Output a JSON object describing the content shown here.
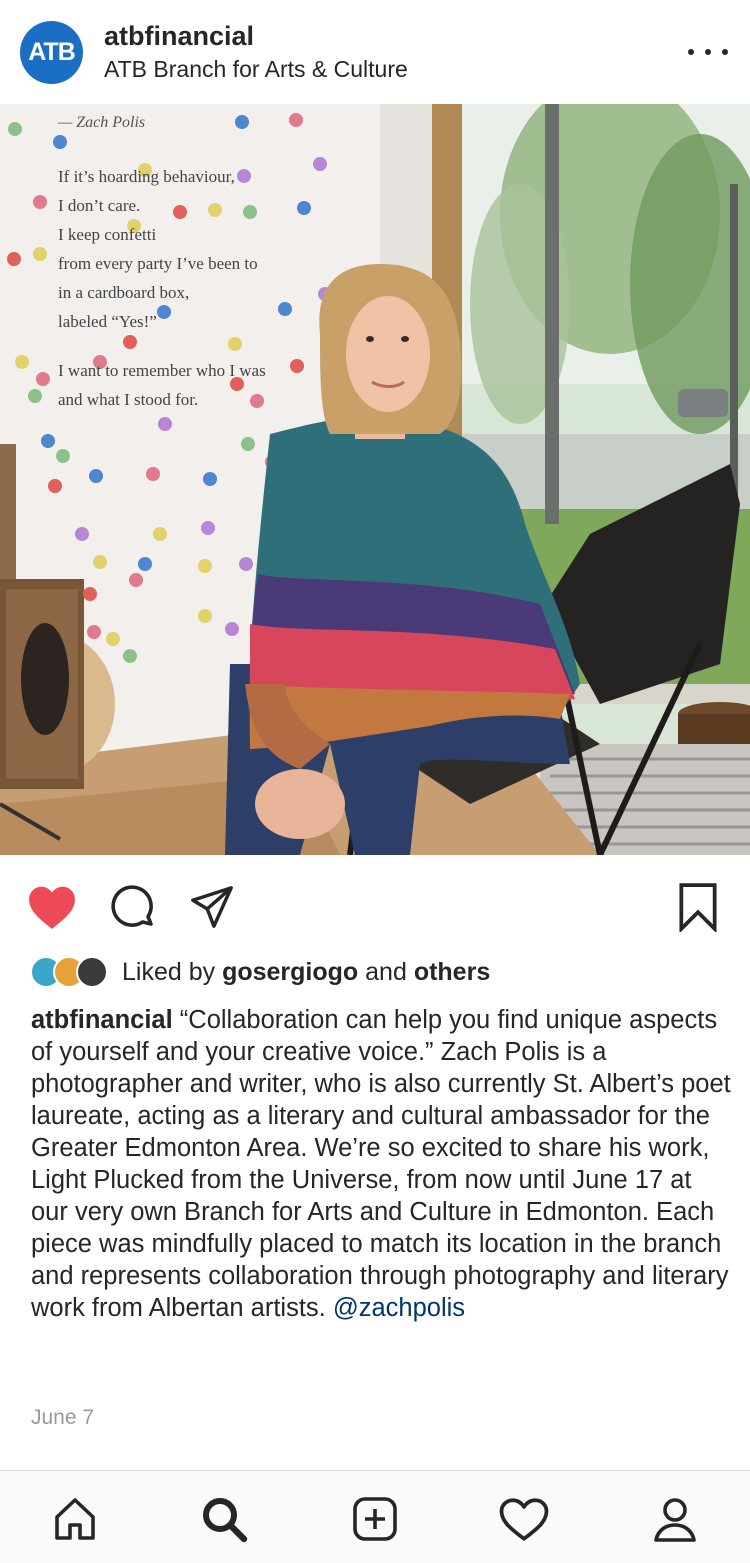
{
  "post": {
    "avatar_text": "ATB",
    "username": "atbfinancial",
    "location": "ATB Branch for Arts & Culture",
    "more_icon": "more-horizontal-icon",
    "liked_by_prefix": "Liked by",
    "liked_by_user": "gosergiogo",
    "liked_by_and": "and",
    "liked_by_others": "others",
    "caption_user": "atbfinancial",
    "caption_text": "“Collaboration can help you find unique aspects of yourself and your creative voice.” Zach Polis is a photographer and writer, who is also currently St. Albert’s poet laureate, acting as a literary and cultural ambassador for the Greater Edmonton Area. We’re so excited to share his work, Light Plucked from the Universe, from now until June 17 at our very own Branch for Arts and Culture in Edmonton. Each piece was mindfully placed to match its location in the branch and represents collaboration through photography and literary work from Albertan artists.",
    "caption_mention": "@zachpolis",
    "date": "June 7",
    "liked": true
  },
  "photo": {
    "credit": "— Zach Polis",
    "poem_lines": [
      "If it’s hoarding behaviour,",
      "I don’t care.",
      "I keep confetti",
      "from every party I’ve been to",
      "in a cardboard box,",
      "labeled “Yes!”"
    ],
    "poem_lines_2": [
      "I want to remember who I was",
      "and what I stood for."
    ]
  },
  "actions": {
    "like_icon": "heart-filled-icon",
    "comment_icon": "comment-icon",
    "share_icon": "send-icon",
    "save_icon": "bookmark-icon"
  },
  "nav": {
    "items": [
      "home-icon",
      "search-icon",
      "new-post-icon",
      "activity-heart-icon",
      "profile-icon"
    ]
  },
  "colors": {
    "like_red": "#ed4956",
    "brand_blue": "#1a6fc4",
    "mention_blue": "#003569",
    "muted_gray": "#999999"
  }
}
